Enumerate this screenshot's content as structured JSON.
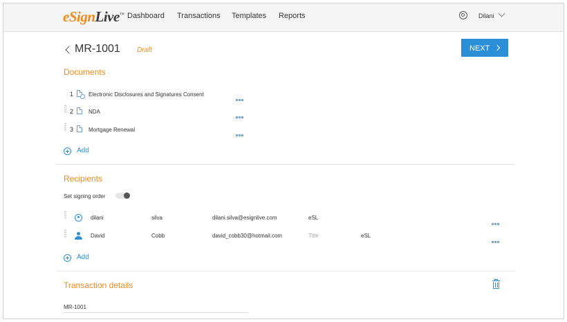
{
  "app": {
    "logo_part1": "eSign",
    "logo_part2": "Live",
    "logo_tm": "™"
  },
  "nav": {
    "items": [
      {
        "label": "Dashboard"
      },
      {
        "label": "Transactions"
      },
      {
        "label": "Templates"
      },
      {
        "label": "Reports"
      }
    ],
    "user_name": "Dilani"
  },
  "header": {
    "title": "MR-1001",
    "status": "Draft",
    "next_label": "NEXT"
  },
  "documents": {
    "section_title": "Documents",
    "items": [
      {
        "number": "1",
        "name": "Electronic Disclosures and Signatures Consent"
      },
      {
        "number": "2",
        "name": "NDA"
      },
      {
        "number": "3",
        "name": "Mortgage Renewal"
      }
    ],
    "add_label": "Add"
  },
  "recipients": {
    "section_title": "Recipients",
    "signing_order_label": "Set signing order",
    "signing_order_enabled": false,
    "rows": [
      {
        "first_name": "dilani",
        "last_name": "silva",
        "email": "dilani.silva@esignlive.com",
        "title": "",
        "company": "eSL",
        "icon": "user-circle-icon"
      },
      {
        "first_name": "David",
        "last_name": "Cobb",
        "email": "david_cobb30@hotmail.com",
        "title_placeholder": "Title",
        "company": "eSL",
        "icon": "person-icon"
      }
    ],
    "add_label": "Add"
  },
  "transaction_details": {
    "section_title": "Transaction details",
    "name_value": "MR-1001"
  },
  "colors": {
    "accent_orange": "#f08a1c",
    "primary_blue": "#2a8fd6"
  }
}
